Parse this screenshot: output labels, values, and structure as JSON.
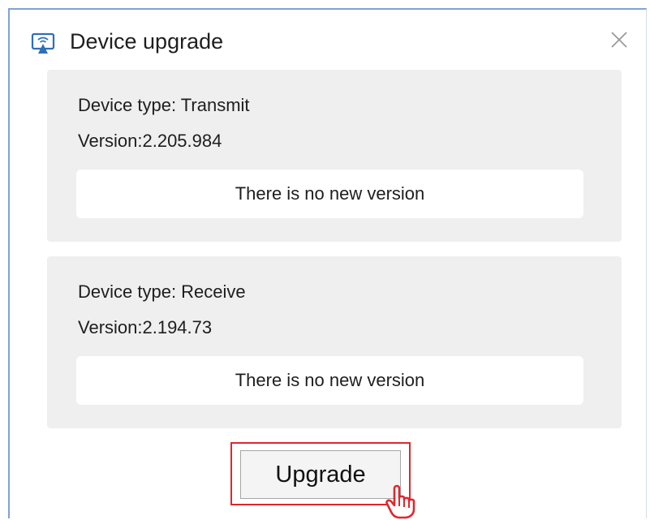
{
  "dialog": {
    "title": "Device upgrade",
    "icon": "screen-cast-icon",
    "close_icon": "close-icon"
  },
  "devices": [
    {
      "type_label": "Device type: Transmit",
      "version_label": "Version:2.205.984",
      "status": "There is no new version"
    },
    {
      "type_label": "Device type: Receive",
      "version_label": "Version:2.194.73",
      "status": "There is no new version"
    }
  ],
  "actions": {
    "upgrade_label": "Upgrade"
  },
  "colors": {
    "panel_background": "#efefef",
    "highlight": "#e0262d",
    "window_border": "#7fa3d6"
  }
}
